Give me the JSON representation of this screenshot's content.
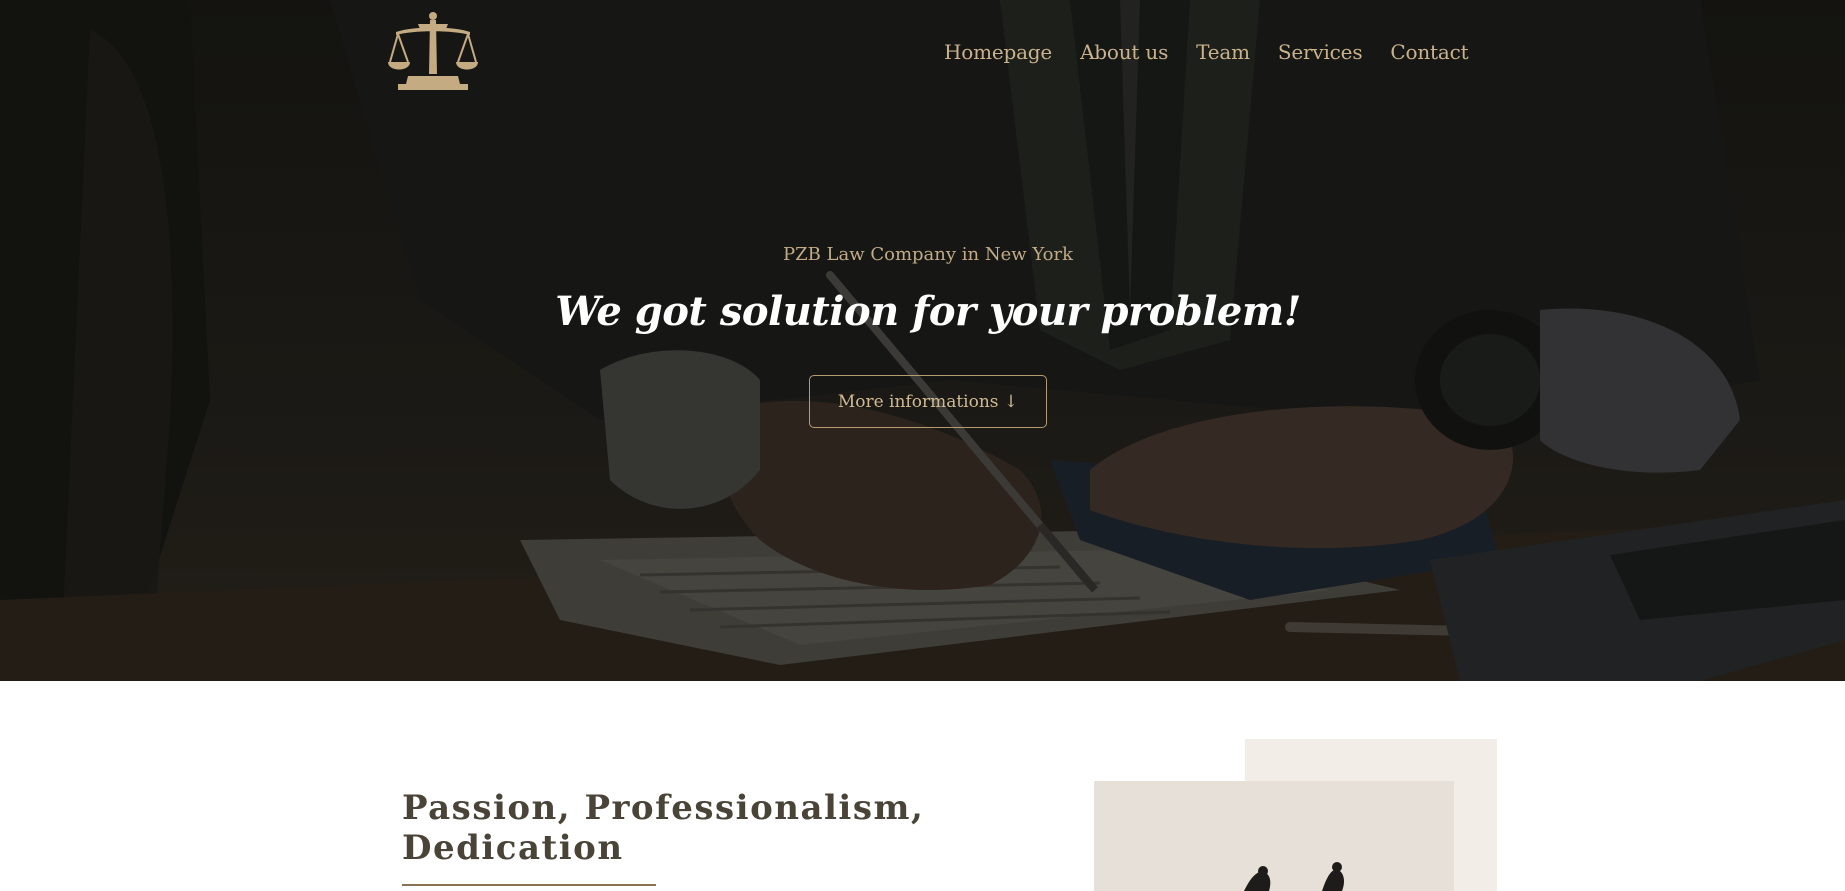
{
  "brand": {
    "logo_icon": "scales-of-justice-icon",
    "accent_color": "#c9b28c",
    "dark_color": "#1c1a16"
  },
  "nav": {
    "items": [
      {
        "label": "Homepage"
      },
      {
        "label": "About us"
      },
      {
        "label": "Team"
      },
      {
        "label": "Services"
      },
      {
        "label": "Contact"
      }
    ]
  },
  "hero": {
    "subtitle": "PZB Law Company in New York",
    "title": "We got solution for your problem!",
    "button_label": "More informations ↓"
  },
  "about": {
    "title_line1": "Passion, Professionalism,",
    "title_line2": "Dedication"
  }
}
